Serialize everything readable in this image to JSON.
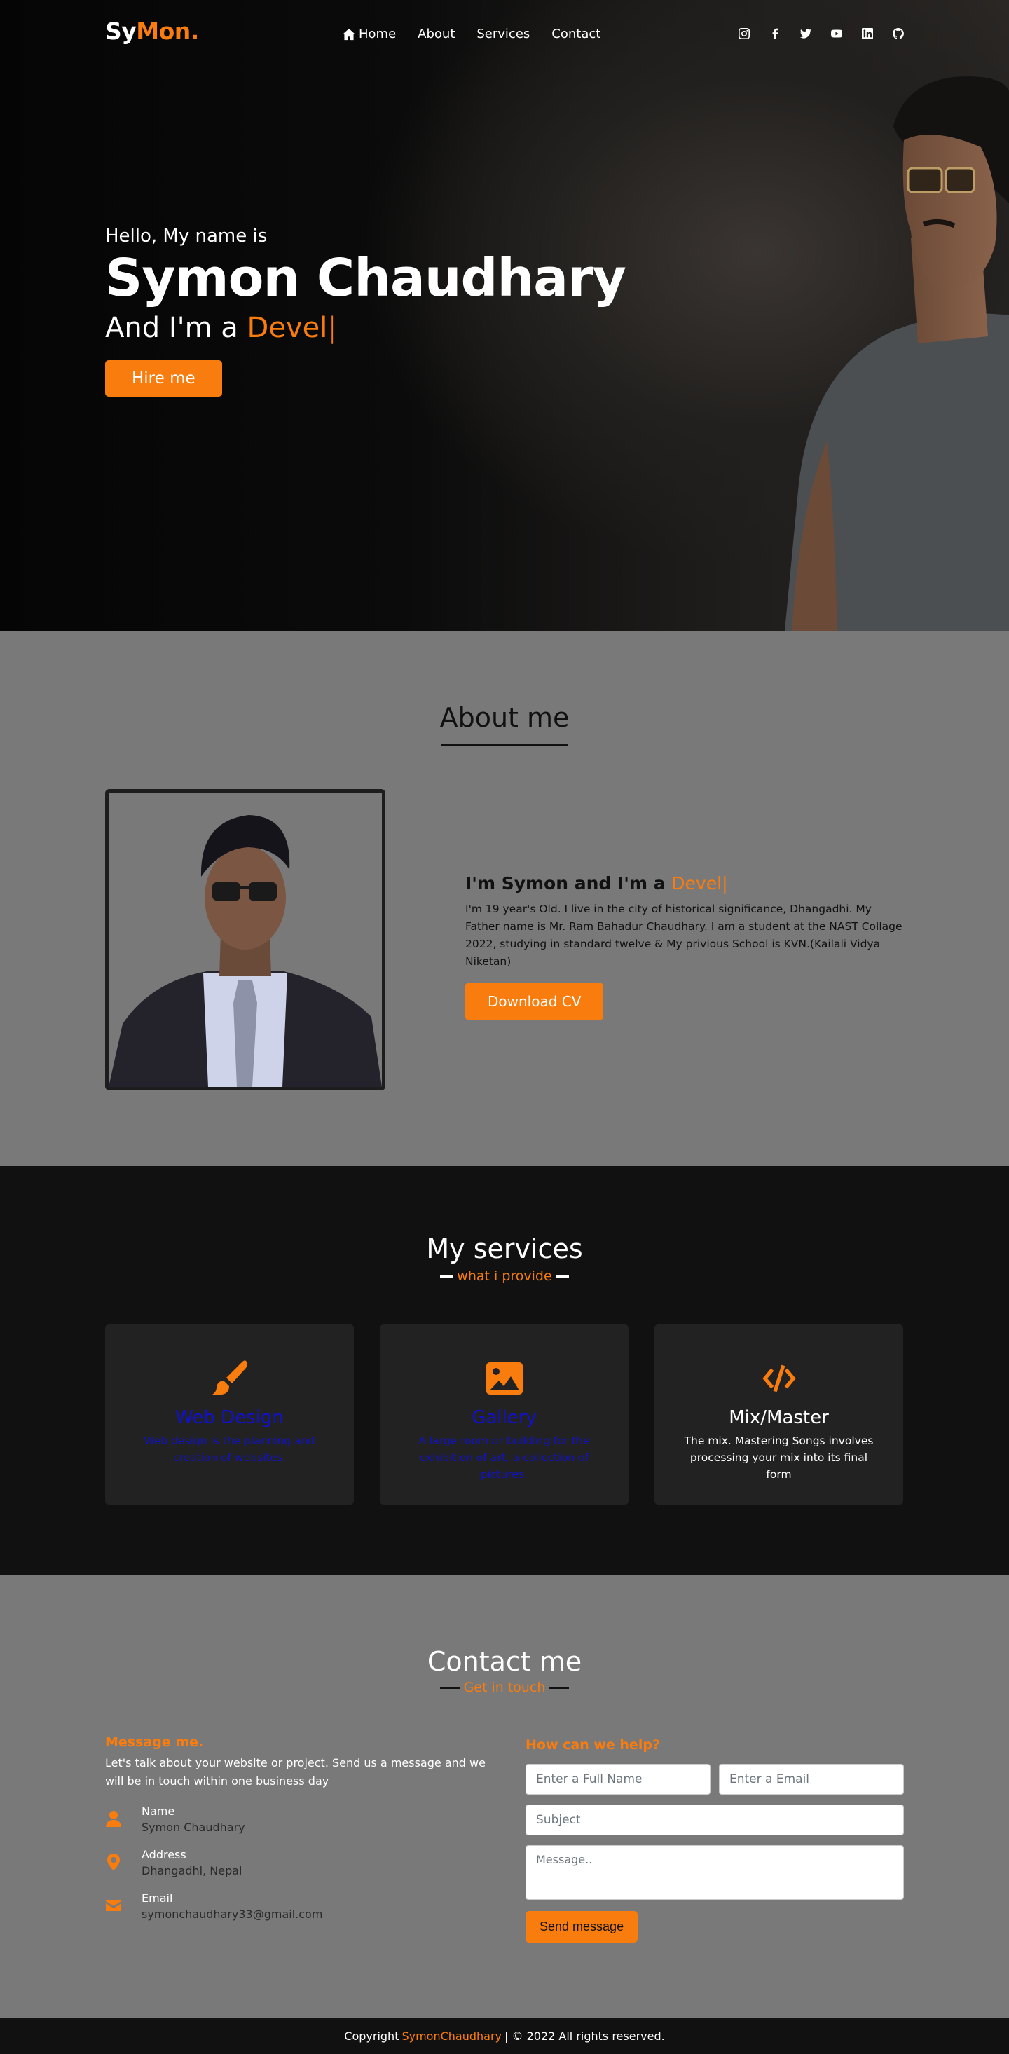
{
  "brand": {
    "part1": "Sy",
    "part2": "Mon."
  },
  "nav": {
    "items": [
      "Home",
      "About",
      "Services",
      "Contact"
    ],
    "home_icon": "home-icon"
  },
  "socials": [
    "instagram-icon",
    "facebook-icon",
    "twitter-icon",
    "youtube-icon",
    "linkedin-icon",
    "github-icon"
  ],
  "hero": {
    "greeting": "Hello, My name is",
    "name": "Symon Chaudhary",
    "role_prefix": "And I'm a ",
    "role_typed": "Devel",
    "cursor": "|",
    "button": "Hire me"
  },
  "about": {
    "title": "About me",
    "heading_prefix": "I'm Symon and I'm a ",
    "heading_typed": "Devel",
    "cursor": "|",
    "body": "I'm 19 year's Old. I live in the city of historical significance, Dhangadhi. My Father name is Mr. Ram Bahadur Chaudhary. I am a student at the NAST Collage 2022, studying in standard twelve & My privious School is KVN.(Kailali Vidya Niketan)",
    "button": "Download CV"
  },
  "services": {
    "title": "My services",
    "subtitle": "what i provide",
    "cards": [
      {
        "icon": "paintbrush-icon",
        "title": "Web Design",
        "desc": "Web design is the planning and creation of websites."
      },
      {
        "icon": "image-icon",
        "title": "Gallery",
        "desc": "A large room or building for the exhibition of art, a collection of pictures."
      },
      {
        "icon": "code-icon",
        "title": "Mix/Master",
        "desc": "The mix. Mastering Songs involves processing your mix into its final form"
      }
    ]
  },
  "contact": {
    "title": "Contact me",
    "subtitle": "Get in touch",
    "left_heading": "Message me.",
    "intro": "Let's talk about your website or project. Send us a message and we will be in touch within one business day",
    "info": [
      {
        "icon": "user-icon",
        "label": "Name",
        "value": "Symon Chaudhary"
      },
      {
        "icon": "location-pin-icon",
        "label": "Address",
        "value": "Dhangadhi, Nepal"
      },
      {
        "icon": "envelope-icon",
        "label": "Email",
        "value": "symonchaudhary33@gmail.com"
      }
    ],
    "right_heading": "How can we help?",
    "form": {
      "name_placeholder": "Enter a Full Name",
      "email_placeholder": "Enter a Email",
      "subject_placeholder": "Subject",
      "message_placeholder": "Message..",
      "button": "Send message"
    }
  },
  "footer": {
    "prefix": "Copyright",
    "name": "SymonChaudhary",
    "suffix": "| © 2022 All rights reserved."
  },
  "colors": {
    "accent": "#f97c0e",
    "dark": "#111111",
    "grey": "#7a7979",
    "card": "#222222",
    "link_blue": "#1111cc"
  }
}
